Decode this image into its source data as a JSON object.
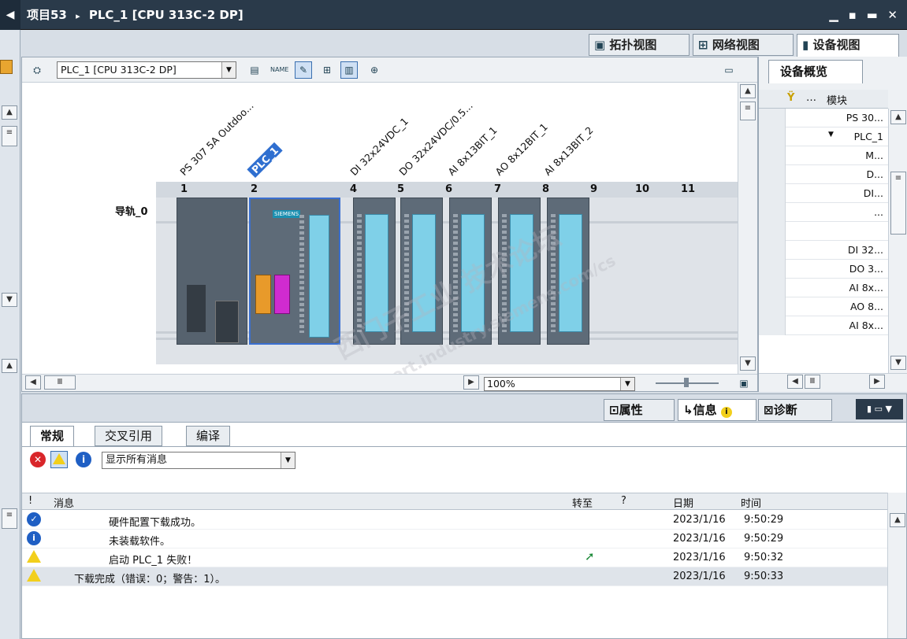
{
  "window": {
    "breadcrumb_project": "项目53",
    "breadcrumb_sep": "▸",
    "breadcrumb_device": "PLC_1 [CPU 313C-2 DP]",
    "controls": "▁ ▪ ▬ ✕"
  },
  "view_tabs": {
    "topology": "拓扑视图",
    "network": "网络视图",
    "device": "设备视图"
  },
  "toolbar": {
    "device_select": "PLC_1 [CPU 313C-2 DP]"
  },
  "rack": {
    "name": "导轨_0",
    "module_labels": [
      "PS 307 5A Outdoo...",
      "PLC_1",
      "DI 32x24VDC_1",
      "DO 32x24VDC/0.5...",
      "AI 8x13BIT_1",
      "AO 8x12BIT_1",
      "AI 8x13BIT_2"
    ],
    "slot_numbers": [
      "1",
      "2",
      "4",
      "5",
      "6",
      "7",
      "8",
      "9",
      "10",
      "11"
    ],
    "cpu_brand": "SIEMENS"
  },
  "zoom": "100%",
  "overview": {
    "tab_title": "设备概览",
    "col_module": "模块",
    "rows": [
      "PS 30...",
      "PLC_1",
      "M...",
      "D...",
      "DI...",
      "...",
      "",
      "DI 32...",
      "DO 3...",
      "AI 8x...",
      "AO 8...",
      "AI 8x..."
    ]
  },
  "info_tabs": {
    "properties": "属性",
    "info": "信息",
    "diagnostics": "诊断"
  },
  "sub_tabs": {
    "general": "常规",
    "cross_ref": "交叉引用",
    "compile": "编译"
  },
  "filter": {
    "label": "显示所有消息"
  },
  "msg_columns": {
    "excl": "!",
    "message": "消息",
    "goto": "转至",
    "question": "?",
    "date": "日期",
    "time": "时间"
  },
  "messages": [
    {
      "type": "ok",
      "text": "硬件配置下载成功。",
      "date": "2023/1/16",
      "time": "9:50:29"
    },
    {
      "type": "info",
      "text": "未装载软件。",
      "date": "2023/1/16",
      "time": "9:50:29"
    },
    {
      "type": "warn",
      "text": "启动 PLC_1 失败！",
      "date": "2023/1/16",
      "time": "9:50:32"
    },
    {
      "type": "warn",
      "text": "下载完成（错误：0；警告：1）。",
      "date": "2023/1/16",
      "time": "9:50:33"
    }
  ],
  "watermark": {
    "line1": "西门子工业 技术论坛",
    "line2": "support.industry.siemens.com/cs"
  }
}
